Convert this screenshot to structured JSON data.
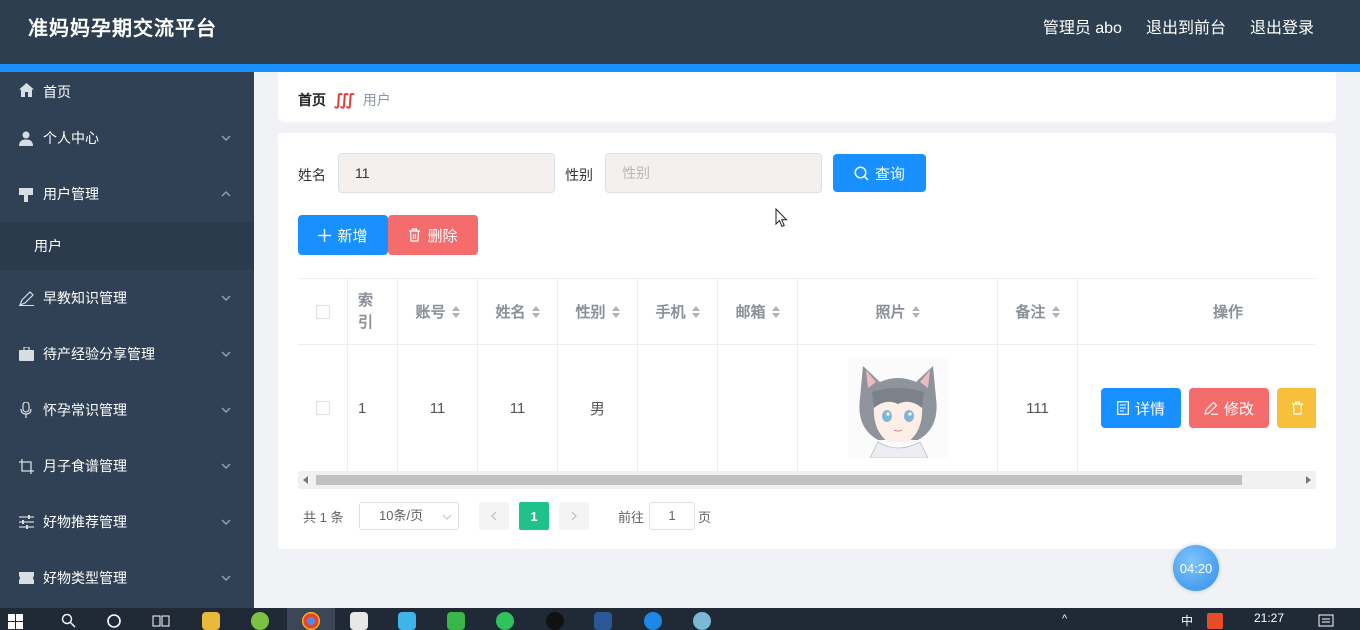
{
  "header": {
    "brand": "准妈妈孕期交流平台",
    "admin": "管理员 abo",
    "front": "退出到前台",
    "logout": "退出登录"
  },
  "sidebar": {
    "items": [
      {
        "label": "首页",
        "icon": "home-icon"
      },
      {
        "label": "个人中心",
        "icon": "user-icon"
      },
      {
        "label": "用户管理",
        "icon": "user-manage-icon",
        "expanded": true
      },
      {
        "label": "用户",
        "sub": true
      },
      {
        "label": "早教知识管理",
        "icon": "pen-icon"
      },
      {
        "label": "待产经验分享管理",
        "icon": "suitcase-icon"
      },
      {
        "label": "怀孕常识管理",
        "icon": "microphone-icon"
      },
      {
        "label": "月子食谱管理",
        "icon": "crop-icon"
      },
      {
        "label": "好物推荐管理",
        "icon": "sliders-icon"
      },
      {
        "label": "好物类型管理",
        "icon": "ticket-icon"
      }
    ]
  },
  "breadcrumb": {
    "home": "首页",
    "current": "用户"
  },
  "search": {
    "name_label": "姓名",
    "name_value": "11",
    "gender_label": "性别",
    "gender_placeholder": "性别",
    "query_button": "查询"
  },
  "actions": {
    "add": "新增",
    "delete": "删除"
  },
  "table": {
    "columns": [
      "索引",
      "账号",
      "姓名",
      "性别",
      "手机",
      "邮箱",
      "照片",
      "备注",
      "操作"
    ],
    "rows": [
      {
        "index": "1",
        "account": "11",
        "name": "11",
        "gender": "男",
        "phone": "",
        "email": "",
        "photo": "anime-cat-boy-avatar",
        "note": "111"
      }
    ],
    "row_buttons": {
      "detail": "详情",
      "edit": "修改"
    }
  },
  "pagination": {
    "total": "共 1 条",
    "page_size": "10条/页",
    "current": "1",
    "goto_prefix": "前往",
    "goto_value": "1",
    "goto_suffix": "页"
  },
  "timer": "04:20",
  "taskbar": {
    "clock": "21:27",
    "ime": "中"
  },
  "colors": {
    "header_bg": "#2c3e50",
    "sidebar_bg": "#304156",
    "accent_blue": "#1890ff",
    "danger": "#f56c6c",
    "warning": "#f7c03a",
    "page_active": "#21c18b"
  }
}
